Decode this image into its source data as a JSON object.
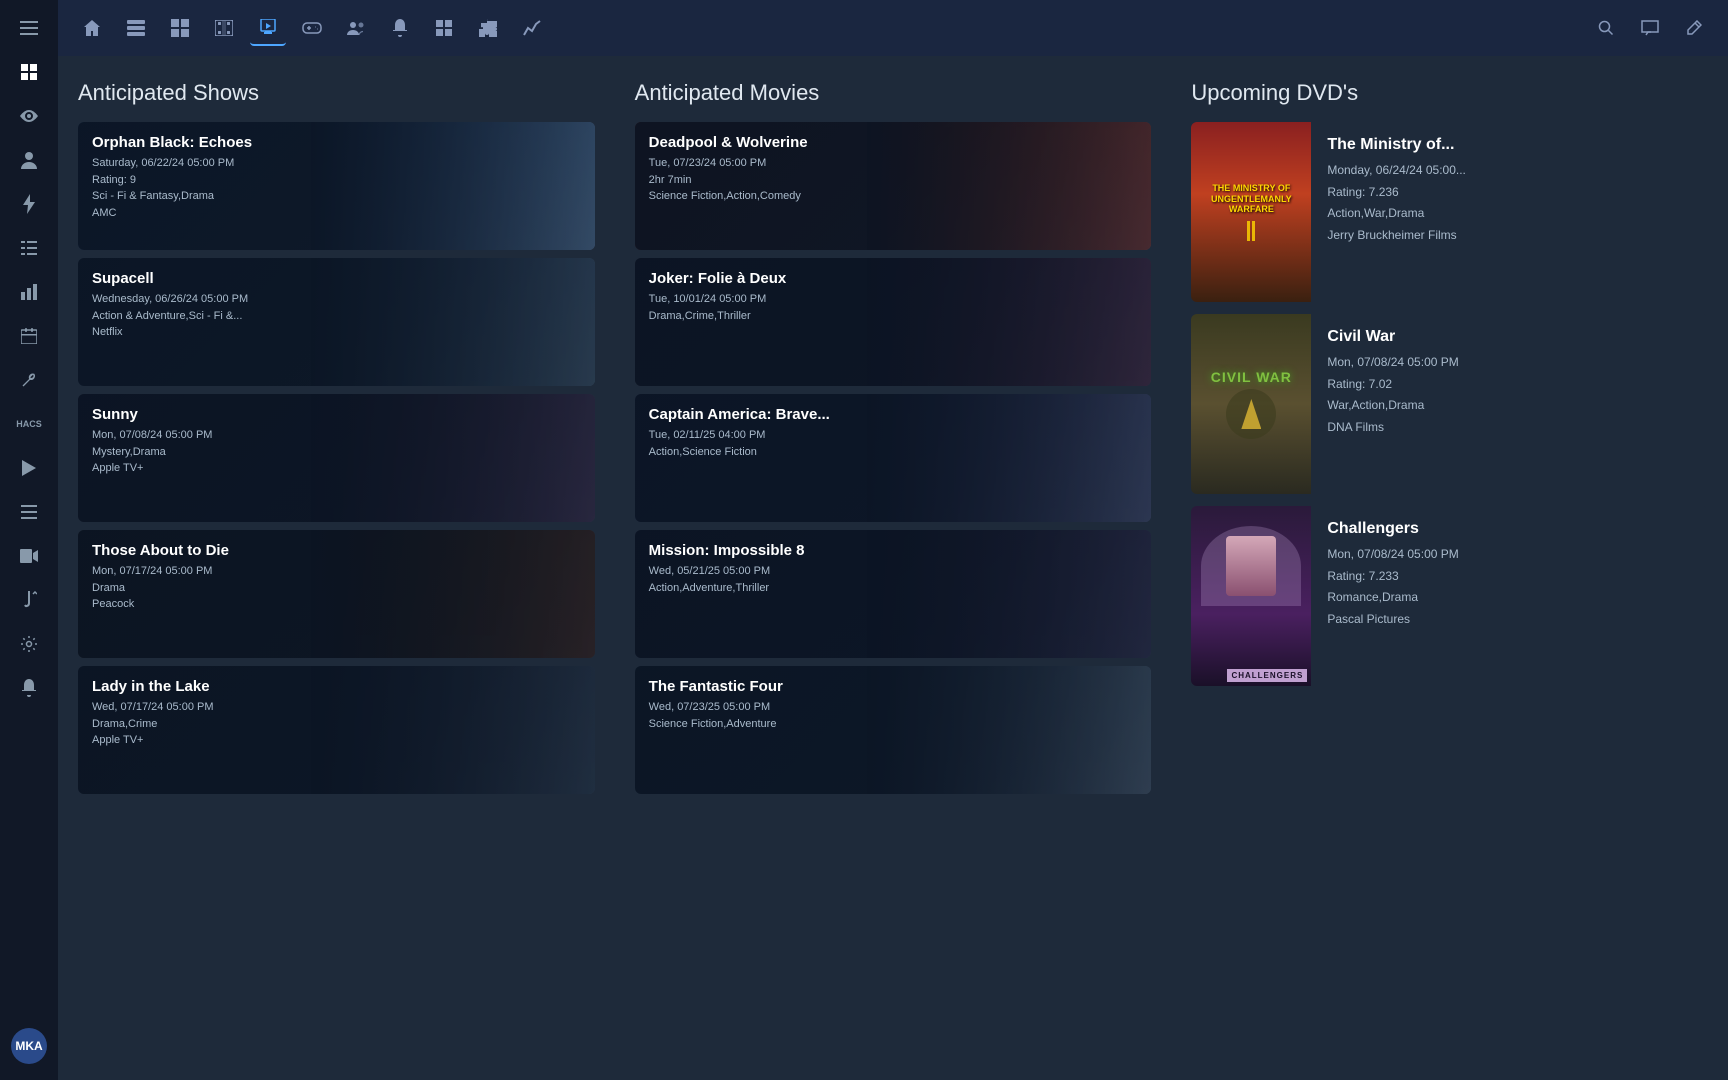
{
  "topnav": {
    "icons": [
      {
        "name": "menu-icon",
        "symbol": "☰"
      },
      {
        "name": "home-icon",
        "symbol": "⌂"
      },
      {
        "name": "tv-guide-icon",
        "symbol": "▦"
      },
      {
        "name": "windows-icon",
        "symbol": "⊞"
      },
      {
        "name": "movie-icon",
        "symbol": "🎬"
      },
      {
        "name": "streaming-icon",
        "symbol": "🎞"
      },
      {
        "name": "gamepad-icon",
        "symbol": "🎮"
      },
      {
        "name": "users-icon",
        "symbol": "👥"
      },
      {
        "name": "bell-icon",
        "symbol": "🔔"
      },
      {
        "name": "grid-icon",
        "symbol": "⊞"
      },
      {
        "name": "puzzle-icon",
        "symbol": "🧩"
      },
      {
        "name": "chart-icon",
        "symbol": "📈"
      }
    ],
    "right_icons": [
      {
        "name": "search-icon",
        "symbol": "🔍"
      },
      {
        "name": "message-icon",
        "symbol": "💬"
      },
      {
        "name": "edit-icon",
        "symbol": "✏️"
      }
    ]
  },
  "sidebar": {
    "icons": [
      {
        "name": "sidebar-dashboard",
        "symbol": "⊞"
      },
      {
        "name": "sidebar-eye",
        "symbol": "👁"
      },
      {
        "name": "sidebar-person",
        "symbol": "👤"
      },
      {
        "name": "sidebar-lightning",
        "symbol": "⚡"
      },
      {
        "name": "sidebar-list",
        "symbol": "≡"
      },
      {
        "name": "sidebar-chart",
        "symbol": "📊"
      },
      {
        "name": "sidebar-calendar",
        "symbol": "📅"
      },
      {
        "name": "sidebar-wrench",
        "symbol": "🔧"
      },
      {
        "name": "sidebar-hacs",
        "symbol": "HACS"
      },
      {
        "name": "sidebar-play",
        "symbol": "▶"
      },
      {
        "name": "sidebar-list2",
        "symbol": "≣"
      },
      {
        "name": "sidebar-video",
        "symbol": "📹"
      },
      {
        "name": "sidebar-hook",
        "symbol": "🪝"
      },
      {
        "name": "sidebar-settings",
        "symbol": "⚙"
      },
      {
        "name": "sidebar-alert",
        "symbol": "🔔"
      }
    ],
    "avatar_label": "MKA"
  },
  "columns": {
    "anticipated_shows": {
      "title": "Anticipated Shows",
      "items": [
        {
          "title": "Orphan Black: Echoes",
          "date": "Saturday, 06/22/24  05:00 PM",
          "rating": "Rating: 9",
          "genres": "Sci - Fi & Fantasy,Drama",
          "network": "AMC",
          "color1": "#1a3050",
          "color2": "#4a6080"
        },
        {
          "title": "Supacell",
          "date": "Wednesday, 06/26/24  05:00 PM",
          "rating": "",
          "genres": "Action & Adventure,Sci - Fi &...",
          "network": "Netflix",
          "color1": "#1a2a40",
          "color2": "#3a5060"
        },
        {
          "title": "Sunny",
          "date": "Mon, 07/08/24  05:00 PM",
          "rating": "",
          "genres": "Mystery,Drama",
          "network": "Apple TV+",
          "color1": "#1a1a2a",
          "color2": "#3a3050"
        },
        {
          "title": "Those About to Die",
          "date": "Mon, 07/17/24  05:00 PM",
          "rating": "",
          "genres": "Drama",
          "network": "Peacock",
          "color1": "#1a1a1a",
          "color2": "#3a3030"
        },
        {
          "title": "Lady in the Lake",
          "date": "Wed, 07/17/24  05:00 PM",
          "rating": "",
          "genres": "Drama,Crime",
          "network": "Apple TV+",
          "color1": "#1a2030",
          "color2": "#2a3a50"
        }
      ]
    },
    "anticipated_movies": {
      "title": "Anticipated Movies",
      "items": [
        {
          "title": "Deadpool & Wolverine",
          "date": "Tue, 07/23/24  05:00 PM",
          "duration": "2hr 7min",
          "genres": "Science Fiction,Action,Comedy",
          "color1": "#3a1010",
          "color2": "#604040"
        },
        {
          "title": "Joker: Folie à Deux",
          "date": "Tue, 10/01/24  05:00 PM",
          "duration": "",
          "genres": "Drama,Crime,Thriller",
          "color1": "#1a1a2a",
          "color2": "#3a2a40"
        },
        {
          "title": "Captain America: Brave...",
          "date": "Tue, 02/11/25  04:00 PM",
          "duration": "",
          "genres": "Action,Science Fiction",
          "color1": "#1a2040",
          "color2": "#3a4060"
        },
        {
          "title": "Mission: Impossible 8",
          "date": "Wed, 05/21/25  05:00 PM",
          "duration": "",
          "genres": "Action,Adventure,Thriller",
          "color1": "#1a1a30",
          "color2": "#2a3050"
        },
        {
          "title": "The Fantastic Four",
          "date": "Wed, 07/23/25  05:00 PM",
          "duration": "",
          "genres": "Science Fiction,Adventure",
          "color1": "#1a2a3a",
          "color2": "#3a4a5a"
        }
      ]
    },
    "upcoming_dvds": {
      "title": "Upcoming DVD's",
      "items": [
        {
          "title": "The Ministry of...",
          "date": "Monday, 06/24/24  05:00...",
          "rating": "Rating: 7.236",
          "genres": "Action,War,Drama",
          "studio": "Jerry Bruckheimer Films",
          "poster_style": "ministry"
        },
        {
          "title": "Civil War",
          "date": "Mon, 07/08/24  05:00 PM",
          "rating": "Rating: 7.02",
          "genres": "War,Action,Drama",
          "studio": "DNA Films",
          "poster_style": "civilwar"
        },
        {
          "title": "Challengers",
          "date": "Mon, 07/08/24  05:00 PM",
          "rating": "Rating: 7.233",
          "genres": "Romance,Drama",
          "studio": "Pascal Pictures",
          "poster_style": "challengers"
        }
      ]
    }
  }
}
